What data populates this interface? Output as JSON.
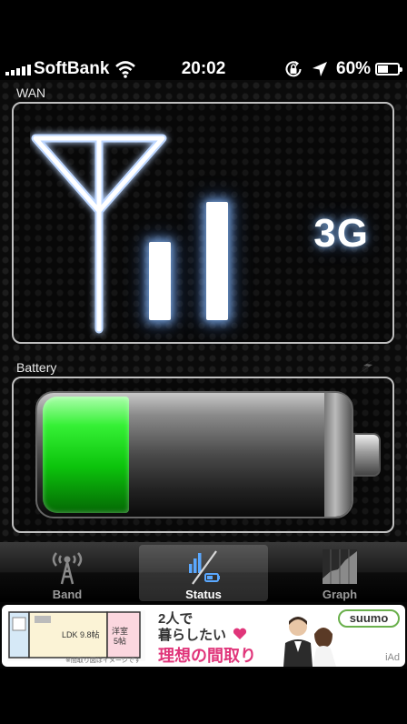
{
  "status_bar": {
    "carrier": "SoftBank",
    "time": "20:02",
    "battery_percent": "60%",
    "battery_level": 0.6
  },
  "wan": {
    "label": "WAN",
    "network_type": "3G",
    "signal_bars_lit": 2
  },
  "battery": {
    "label": "Battery",
    "charge_level": 0.3
  },
  "tabs": [
    {
      "label": "Band",
      "icon": "antenna-tower-icon",
      "selected": false
    },
    {
      "label": "Status",
      "icon": "status-signal-battery-icon",
      "selected": true
    },
    {
      "label": "Graph",
      "icon": "graph-icon",
      "selected": false
    }
  ],
  "ad": {
    "floorplan_ldk": "LDK 9.8帖",
    "floorplan_room": "洋室",
    "floorplan_room_size": "5帖",
    "floorplan_note": "※間取り図はイメージです",
    "headline_1": "2人で",
    "headline_2": "暮らしたい",
    "headline_3": "理想の間取り",
    "brand": "suumo",
    "network": "iAd"
  },
  "colors": {
    "battery_green": "#0cc40c",
    "glow_blue": "#8cbeff",
    "ad_pink": "#e0357a",
    "suumo_green": "#6ab04c"
  }
}
